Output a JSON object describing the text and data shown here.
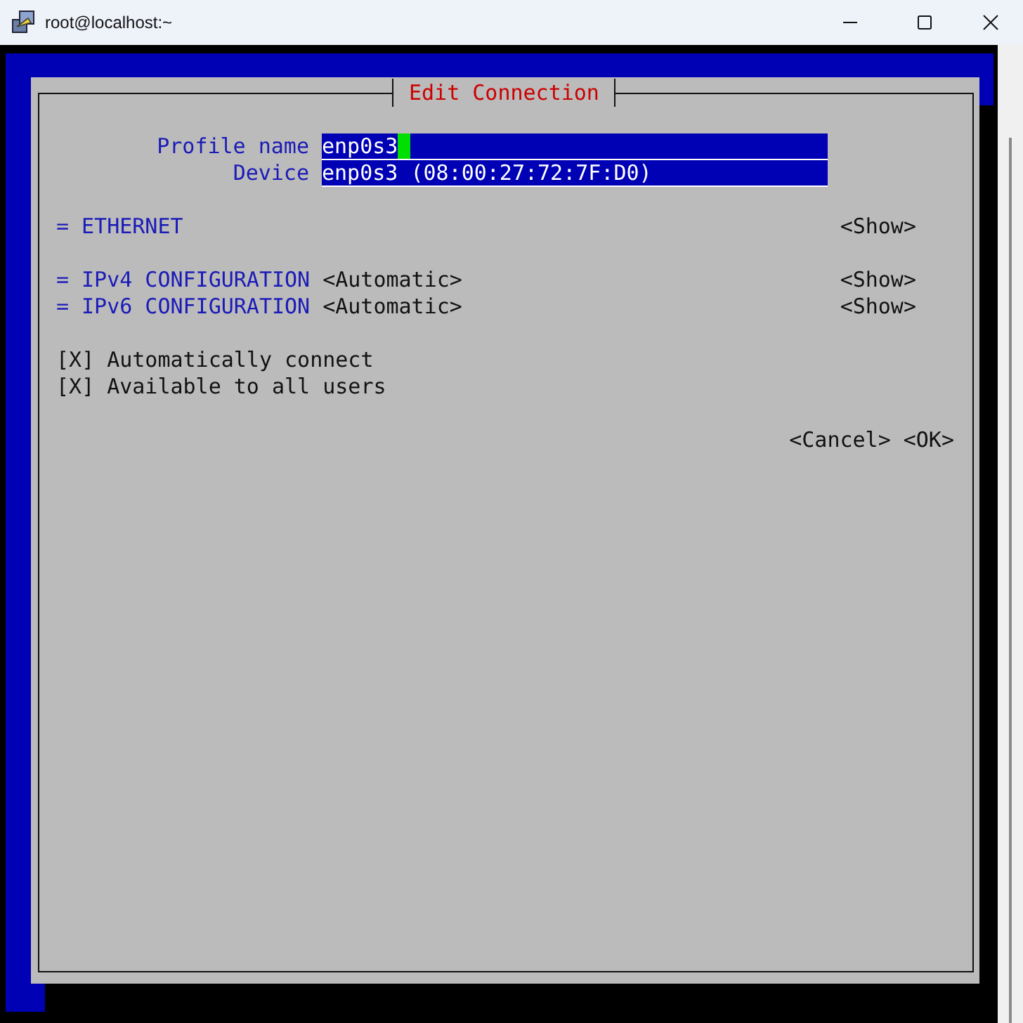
{
  "window": {
    "title": "root@localhost:~"
  },
  "dialog": {
    "title": "Edit Connection",
    "fields": [
      {
        "label": "Profile name",
        "value": "enp0s3",
        "focused": true
      },
      {
        "label": "Device",
        "value": "enp0s3 (08:00:27:72:7F:D0)",
        "focused": false
      }
    ],
    "ethernet": {
      "marker": "=",
      "title": "ETHERNET",
      "action": "<Show>"
    },
    "ip_sections": [
      {
        "marker": "=",
        "title": "IPv4 CONFIGURATION",
        "value": "<Automatic>",
        "action": "<Show>"
      },
      {
        "marker": "=",
        "title": "IPv6 CONFIGURATION",
        "value": "<Automatic>",
        "action": "<Show>"
      }
    ],
    "checkboxes": [
      {
        "box": [
          "[",
          "X",
          "]"
        ],
        "checked": true,
        "label": "Automatically connect"
      },
      {
        "box": [
          "[",
          "X",
          "]"
        ],
        "checked": true,
        "label": "Available to all users"
      }
    ],
    "buttons": [
      "<Cancel>",
      "<OK>"
    ]
  }
}
